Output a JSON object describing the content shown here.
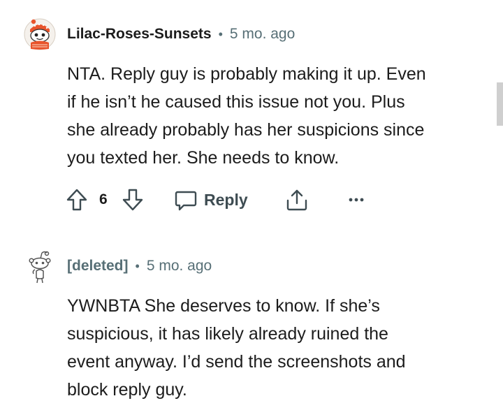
{
  "comments": [
    {
      "username": "Lilac-Roses-Sunsets",
      "separator": "•",
      "time": "5 mo. ago",
      "avatar_icon": "snoo-avatar-icon",
      "lines": [
        "NTA. Reply guy is probably making it up. Even",
        "if he isn’t he caused this issue not you. Plus",
        "she already probably has her suspicions since",
        "you texted her. She needs to know."
      ],
      "score": "6",
      "reply_label": "Reply"
    },
    {
      "username": "[deleted]",
      "separator": "•",
      "time": "5 mo. ago",
      "avatar_icon": "deleted-snoo-avatar-icon",
      "lines": [
        "YWNBTA She deserves to know. If she’s",
        "suspicious, it has likely already ruined the",
        "event anyway. I’d send the screenshots and",
        "block reply guy."
      ]
    }
  ],
  "colors": {
    "text": "#1c1c1c",
    "meta": "#576f76",
    "action": "#3e4c52",
    "scrollbar": "#cfcfcf",
    "avatar_orange": "#e8542c"
  }
}
